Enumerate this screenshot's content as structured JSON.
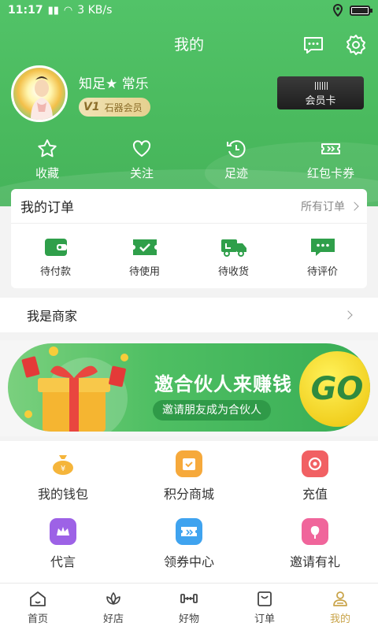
{
  "status_bar": {
    "time": "11:17",
    "net_speed": "3 KB/s"
  },
  "title": "我的",
  "profile": {
    "username": "知足★ 常乐",
    "vip_level": "V1",
    "vip_label": "石器会员",
    "member_card": "会员卡"
  },
  "quick_links": [
    {
      "label": "收藏",
      "icon": "star-icon"
    },
    {
      "label": "关注",
      "icon": "heart-icon"
    },
    {
      "label": "足迹",
      "icon": "history-icon"
    },
    {
      "label": "红包卡券",
      "icon": "ticket-icon"
    }
  ],
  "orders": {
    "title": "我的订单",
    "all_label": "所有订单",
    "items": [
      {
        "label": "待付款",
        "icon": "wallet-icon"
      },
      {
        "label": "待使用",
        "icon": "check-ticket-icon"
      },
      {
        "label": "待收货",
        "icon": "truck-icon"
      },
      {
        "label": "待评价",
        "icon": "comment-icon"
      }
    ]
  },
  "merchant": {
    "label": "我是商家"
  },
  "banner": {
    "title": "邀合伙人来赚钱",
    "subtitle": "邀请朋友成为合伙人",
    "go": "GO"
  },
  "services": [
    {
      "label": "我的钱包",
      "icon": "money-bag-icon",
      "color": "#f5b53b"
    },
    {
      "label": "积分商城",
      "icon": "points-mall-icon",
      "color": "#f6a93b"
    },
    {
      "label": "充值",
      "icon": "recharge-icon",
      "color": "#f16063"
    },
    {
      "label": "代言",
      "icon": "crown-icon",
      "color": "#9d62e6"
    },
    {
      "label": "领券中心",
      "icon": "coupon-icon",
      "color": "#3fa3ef"
    },
    {
      "label": "邀请有礼",
      "icon": "flower-icon",
      "color": "#f0659b"
    }
  ],
  "tabs": [
    {
      "label": "首页",
      "icon": "home-icon"
    },
    {
      "label": "好店",
      "icon": "lotus-icon"
    },
    {
      "label": "好物",
      "icon": "dumbbell-icon"
    },
    {
      "label": "订单",
      "icon": "order-bag-icon"
    },
    {
      "label": "我的",
      "icon": "user-icon",
      "active": true
    }
  ],
  "colors": {
    "primary_green": "#4aba5e",
    "active_tab": "#c9a44a"
  }
}
